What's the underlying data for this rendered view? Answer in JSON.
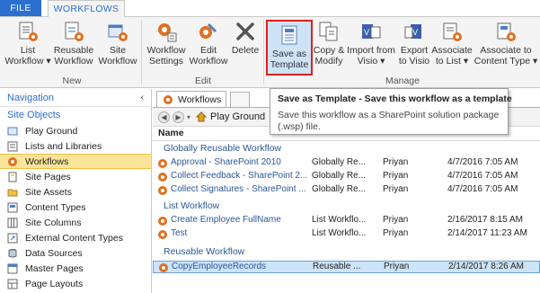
{
  "tabs": {
    "file": "FILE",
    "workflows": "WORKFLOWS"
  },
  "ribbon": {
    "new": {
      "label": "New",
      "buttons": [
        {
          "line1": "List",
          "line2": "Workflow ▾"
        },
        {
          "line1": "Reusable",
          "line2": "Workflow"
        },
        {
          "line1": "Site",
          "line2": "Workflow"
        }
      ]
    },
    "edit": {
      "label": "Edit",
      "buttons": [
        {
          "line1": "Workflow",
          "line2": "Settings"
        },
        {
          "line1": "Edit",
          "line2": "Workflow"
        },
        {
          "line1": "Delete",
          "line2": ""
        }
      ]
    },
    "manage": {
      "label": "Manage",
      "buttons": [
        {
          "line1": "Save as",
          "line2": "Template"
        },
        {
          "line1": "Copy &",
          "line2": "Modify"
        },
        {
          "line1": "Import from",
          "line2": "Visio ▾"
        },
        {
          "line1": "Export",
          "line2": "to Visio"
        },
        {
          "line1": "Associate",
          "line2": "to List ▾"
        },
        {
          "line1": "Associate to",
          "line2": "Content Type ▾"
        }
      ]
    }
  },
  "tooltip": {
    "title": "Save as Template - Save this workflow as a template",
    "body": "Save this workflow as a SharePoint solution package (.wsp) file."
  },
  "nav": {
    "title": "Navigation",
    "section": "Site Objects",
    "items": [
      {
        "label": "Play Ground",
        "icon": "site-icon"
      },
      {
        "label": "Lists and Libraries",
        "icon": "list-icon"
      },
      {
        "label": "Workflows",
        "icon": "workflow-icon"
      },
      {
        "label": "Site Pages",
        "icon": "page-icon"
      },
      {
        "label": "Site Assets",
        "icon": "folder-icon"
      },
      {
        "label": "Content Types",
        "icon": "content-type-icon"
      },
      {
        "label": "Site Columns",
        "icon": "columns-icon"
      },
      {
        "label": "External Content Types",
        "icon": "external-icon"
      },
      {
        "label": "Data Sources",
        "icon": "database-icon"
      },
      {
        "label": "Master Pages",
        "icon": "master-page-icon"
      },
      {
        "label": "Page Layouts",
        "icon": "layout-icon"
      }
    ],
    "active_index": 2
  },
  "main": {
    "tab_label": "Workflows",
    "address": "Play Ground",
    "column_name": "Name",
    "groups": [
      {
        "title": "Globally Reusable Workflow",
        "rows": [
          {
            "name": "Approval - SharePoint 2010",
            "type": "Globally Re...",
            "modified_by": "Priyan",
            "modified": "4/7/2016 7:05 AM"
          },
          {
            "name": "Collect Feedback - SharePoint 2...",
            "type": "Globally Re...",
            "modified_by": "Priyan",
            "modified": "4/7/2016 7:05 AM"
          },
          {
            "name": "Collect Signatures - SharePoint ...",
            "type": "Globally Re...",
            "modified_by": "Priyan",
            "modified": "4/7/2016 7:05 AM"
          }
        ]
      },
      {
        "title": "List Workflow",
        "rows": [
          {
            "name": "Create Employee FullName",
            "type": "List Workflo...",
            "modified_by": "Priyan",
            "modified": "2/16/2017 8:15 AM"
          },
          {
            "name": "Test",
            "type": "List Workflo...",
            "modified_by": "Priyan",
            "modified": "2/14/2017 11:23 AM"
          }
        ]
      },
      {
        "title": "Reusable Workflow",
        "rows": [
          {
            "name": "CopyEmployeeRecords",
            "type": "Reusable ...",
            "modified_by": "Priyan",
            "modified": "2/14/2017 8:26 AM"
          }
        ]
      }
    ]
  },
  "colors": {
    "accent": "#2b6fd0",
    "highlight_box": "#e02020",
    "active_nav": "#fde49a",
    "link": "#2b5797"
  }
}
